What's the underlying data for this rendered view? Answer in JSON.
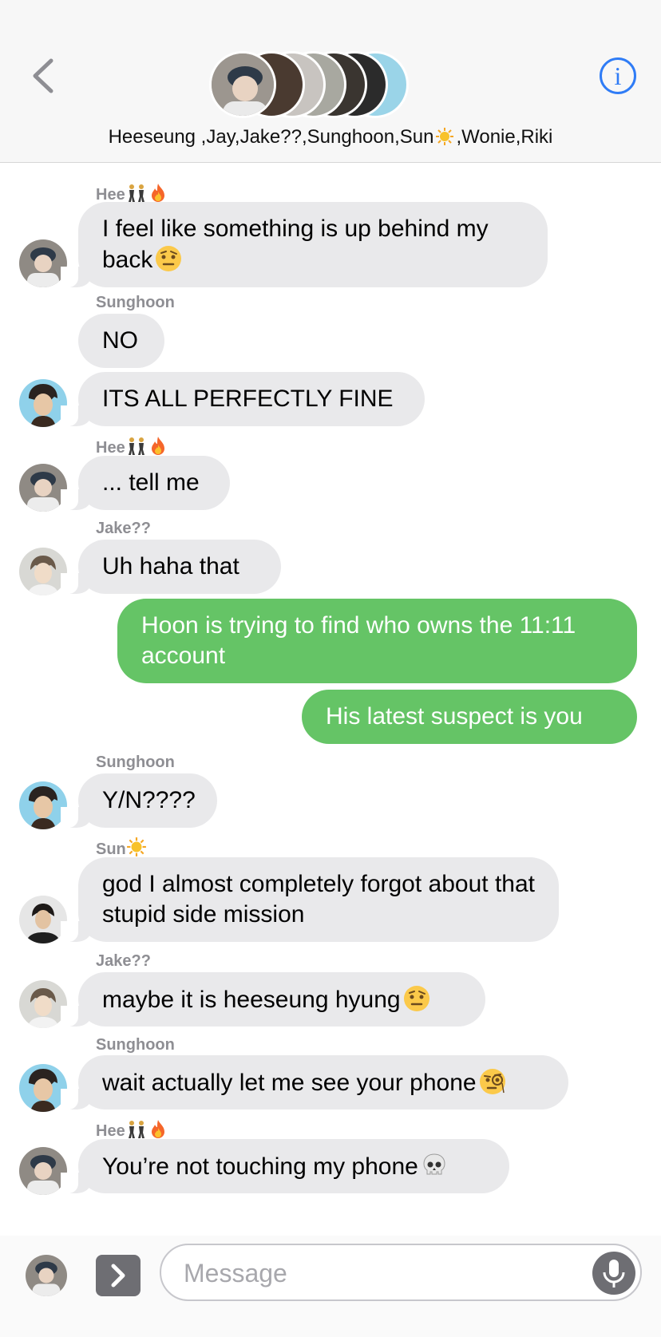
{
  "header": {
    "title_parts": [
      "Heeseung ,Jay,Jake??,Sunghoon,Sun",
      ",Wonie,Riki"
    ],
    "info_symbol": "i"
  },
  "messages": [
    {
      "sender": "Hee",
      "text": "I feel like something is up behind my back"
    },
    {
      "sender": "Sunghoon",
      "text": "NO"
    },
    {
      "text": "ITS ALL PERFECTLY FINE"
    },
    {
      "sender": "Hee",
      "text": "... tell me"
    },
    {
      "sender": "Jake??",
      "text": "Uh haha that"
    },
    {
      "text": "Hoon is trying to find who owns the 11:11 account"
    },
    {
      "text": "His latest suspect is you"
    },
    {
      "sender": "Sunghoon",
      "text": "Y/N????"
    },
    {
      "sender": "Sun",
      "text": "god I almost completely forgot about that stupid side mission"
    },
    {
      "sender": "Jake??",
      "text": "maybe it is heeseung hyung"
    },
    {
      "sender": "Sunghoon",
      "text": "wait actually let me see your phone"
    },
    {
      "sender": "Hee",
      "text": "You’re not touching my phone"
    }
  ],
  "input": {
    "placeholder": "Message"
  },
  "colors": {
    "sent_bubble": "#65c466",
    "received_bubble": "#e9e9eb",
    "accent": "#2f7cf6"
  }
}
